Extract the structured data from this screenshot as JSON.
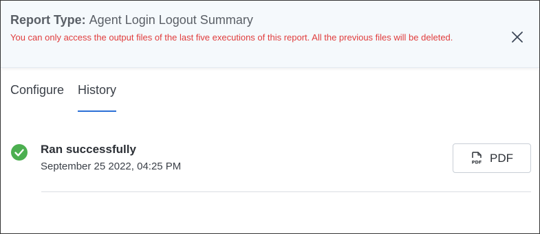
{
  "header": {
    "title_prefix": "Report Type:",
    "title_value": "Agent Login Logout Summary",
    "warning": "You can only access the output files of the last five executions of this report. All the previous files will be deleted."
  },
  "tabs": [
    {
      "label": "Configure",
      "active": false
    },
    {
      "label": "History",
      "active": true
    }
  ],
  "history": {
    "runs": [
      {
        "status": "Ran successfully",
        "timestamp": "September 25 2022, 04:25 PM",
        "download_label": "PDF",
        "status_icon": "check-circle-icon"
      }
    ]
  },
  "icons": {
    "close": "close-icon",
    "pdf": "pdf-file-icon"
  },
  "colors": {
    "warning_text": "#e03c3c",
    "active_tab_underline": "#2a6fd6",
    "success": "#4caf50",
    "header_bg": "#f5f9fc"
  }
}
